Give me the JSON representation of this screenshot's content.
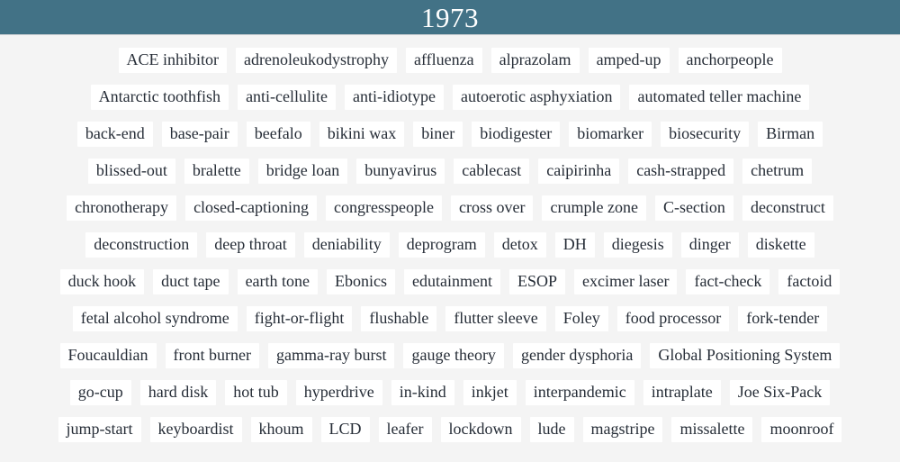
{
  "header": {
    "title": "1973",
    "background_color": "#427286",
    "text_color": "#ffffff"
  },
  "page": {
    "background_color": "#f4f4f4",
    "chip_background_color": "#ffffff",
    "chip_text_color": "#262d37"
  },
  "cloud": {
    "rows": [
      {
        "words": [
          "ACE inhibitor",
          "adrenoleukodystrophy",
          "affluenza",
          "alprazolam",
          "amped-up",
          "anchorpeople"
        ]
      },
      {
        "words": [
          "Antarctic toothfish",
          "anti-cellulite",
          "anti-idiotype",
          "autoerotic asphyxiation",
          "automated teller machine"
        ]
      },
      {
        "words": [
          "back-end",
          "base-pair",
          "beefalo",
          "bikini wax",
          "biner",
          "biodigester",
          "biomarker",
          "biosecurity",
          "Birman"
        ]
      },
      {
        "words": [
          "blissed-out",
          "bralette",
          "bridge loan",
          "bunyavirus",
          "cablecast",
          "caipirinha",
          "cash-strapped",
          "chetrum"
        ]
      },
      {
        "words": [
          "chronotherapy",
          "closed-captioning",
          "congresspeople",
          "cross over",
          "crumple zone",
          "C-section",
          "deconstruct"
        ]
      },
      {
        "words": [
          "deconstruction",
          "deep throat",
          "deniability",
          "deprogram",
          "detox",
          "DH",
          "diegesis",
          "dinger",
          "diskette"
        ]
      },
      {
        "words": [
          "duck hook",
          "duct tape",
          "earth tone",
          "Ebonics",
          "edutainment",
          "ESOP",
          "excimer laser",
          "fact-check",
          "factoid"
        ]
      },
      {
        "words": [
          "fetal alcohol syndrome",
          "fight-or-flight",
          "flushable",
          "flutter sleeve",
          "Foley",
          "food processor",
          "fork-tender"
        ]
      },
      {
        "words": [
          "Foucauldian",
          "front burner",
          "gamma-ray burst",
          "gauge theory",
          "gender dysphoria",
          "Global Positioning System"
        ]
      },
      {
        "words": [
          "go-cup",
          "hard disk",
          "hot tub",
          "hyperdrive",
          "in-kind",
          "inkjet",
          "interpandemic",
          "intraplate",
          "Joe Six-Pack"
        ]
      },
      {
        "words": [
          "jump-start",
          "keyboardist",
          "khoum",
          "LCD",
          "leafer",
          "lockdown",
          "lude",
          "magstripe",
          "missalette",
          "moonroof"
        ]
      }
    ]
  }
}
